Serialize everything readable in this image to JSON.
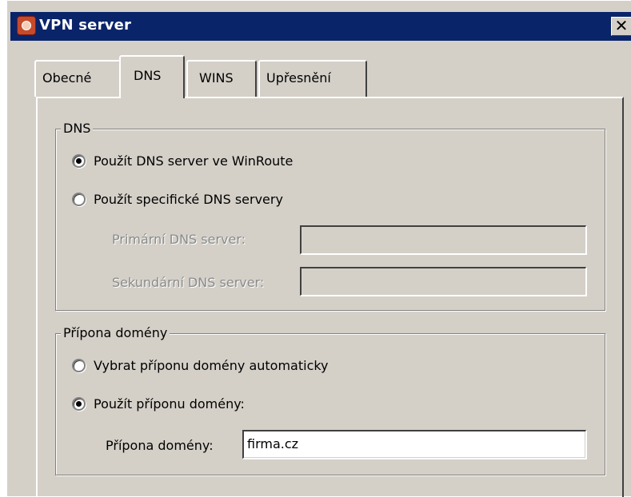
{
  "window": {
    "title": "VPN server",
    "app_icon": "vpn-server-icon",
    "close_symbol": "✕"
  },
  "tabs": [
    {
      "label": "Obecné",
      "active": false
    },
    {
      "label": "DNS",
      "active": true
    },
    {
      "label": "WINS",
      "active": false
    },
    {
      "label": "Upřesnění",
      "active": false
    }
  ],
  "dns_group": {
    "legend": "DNS",
    "option_winroute": {
      "label": "Použít DNS server ve WinRoute",
      "checked": true
    },
    "option_specific": {
      "label": "Použít specifické DNS servery",
      "checked": false
    },
    "primary": {
      "label": "Primární DNS server:",
      "value": "",
      "disabled": true
    },
    "secondary": {
      "label": "Sekundární DNS server:",
      "value": "",
      "disabled": true
    }
  },
  "domain_group": {
    "legend": "Přípona domény",
    "option_auto": {
      "label": "Vybrat příponu domény automaticky",
      "checked": false
    },
    "option_use": {
      "label": "Použít příponu domény:",
      "checked": true
    },
    "suffix": {
      "label": "Přípona domény:",
      "value": "firma.cz"
    }
  },
  "colors": {
    "title_bar": "#0a246a",
    "dialog_face": "#d4d0c8"
  }
}
